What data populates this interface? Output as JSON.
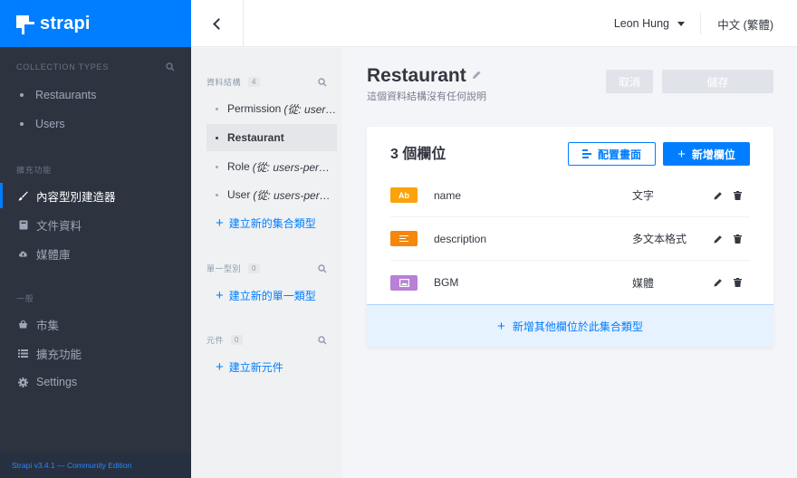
{
  "brand": {
    "name": "strapi",
    "accent": "#007eff"
  },
  "sidebar": {
    "collection_header": "COLLECTION TYPES",
    "collections": [
      {
        "label": "Restaurants"
      },
      {
        "label": "Users"
      }
    ],
    "plugins_header": "擴充功能",
    "plugins": [
      {
        "label": "內容型別建造器",
        "icon": "paintbrush-icon",
        "active": true
      },
      {
        "label": "文件資料",
        "icon": "book-icon"
      },
      {
        "label": "媒體庫",
        "icon": "cloud-upload-icon"
      }
    ],
    "general_header": "一般",
    "general": [
      {
        "label": "市集",
        "icon": "shop-icon"
      },
      {
        "label": "擴充功能",
        "icon": "list-icon"
      },
      {
        "label": "Settings",
        "icon": "gear-icon"
      }
    ],
    "footer": "Strapi v3.4.1 — Community Edition"
  },
  "header": {
    "user": "Leon Hung",
    "language": "中文 (繁體)"
  },
  "subnav": {
    "collections_header": "資料結構",
    "collections_count": "4",
    "items": [
      {
        "label": "Permission",
        "note": "(從: users-permissions)"
      },
      {
        "label": "Restaurant",
        "note": ""
      },
      {
        "label": "Role",
        "note": "(從: users-permissions)"
      },
      {
        "label": "User",
        "note": "(從: users-permissions)"
      }
    ],
    "add_collection": "建立新的集合類型",
    "singles_header": "單一型別",
    "singles_count": "0",
    "add_single": "建立新的單一類型",
    "components_header": "元件",
    "components_count": "0",
    "add_component": "建立新元件"
  },
  "main": {
    "title": "Restaurant",
    "description": "這個資料結構沒有任何說明",
    "cancel": "取消",
    "save": "儲存",
    "fields_title": "3 個欄位",
    "configure_view": "配置畫面",
    "add_field": "新增欄位",
    "fields": [
      {
        "name": "name",
        "type": "文字",
        "badge": "Ab",
        "color": "#faa30c"
      },
      {
        "name": "description",
        "type": "多文本格式",
        "badge": "",
        "color": "#f4870e"
      },
      {
        "name": "BGM",
        "type": "媒體",
        "badge": "",
        "color": "#b880d6"
      }
    ],
    "add_another": "新增其他欄位於此集合類型"
  }
}
